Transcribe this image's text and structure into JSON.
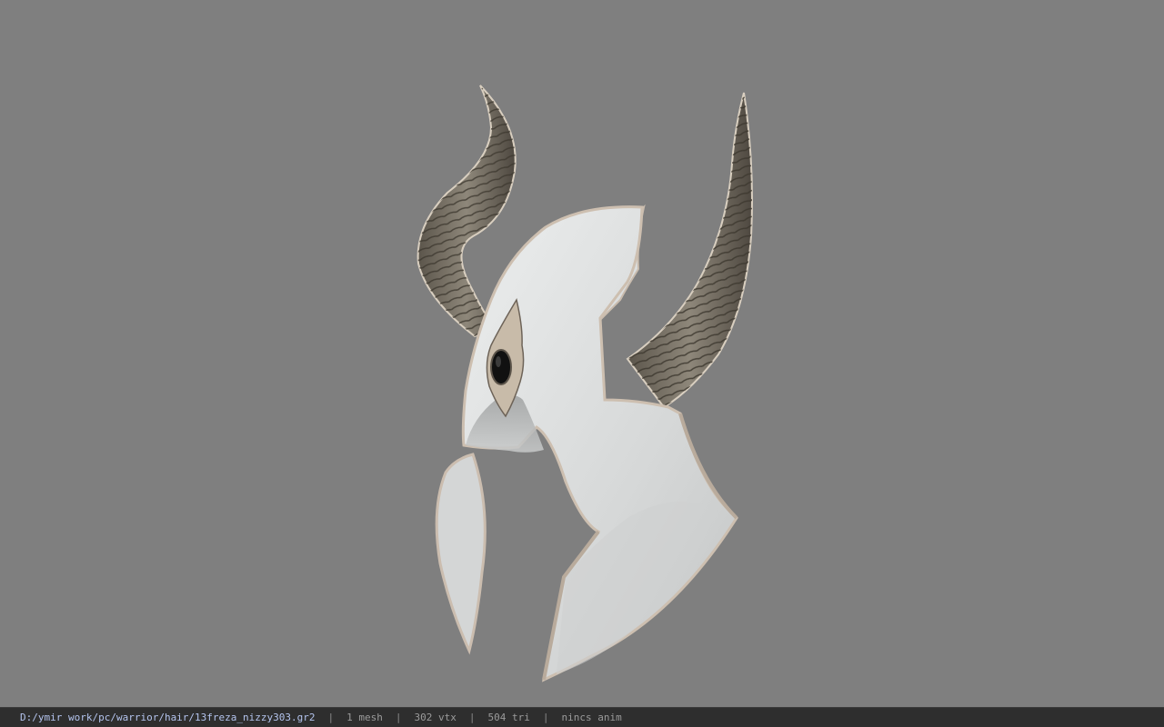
{
  "viewport": {
    "background": "#7f7f7f",
    "model": "horned-helmet-model"
  },
  "statusbar": {
    "file_path": "D:/ymir work/pc/warrior/hair/13freza_nizzy303.gr2",
    "mesh_count": "1 mesh",
    "vertex_count": "302 vtx",
    "triangle_count": "504 tri",
    "animation": "nincs anim",
    "separator": "|"
  }
}
